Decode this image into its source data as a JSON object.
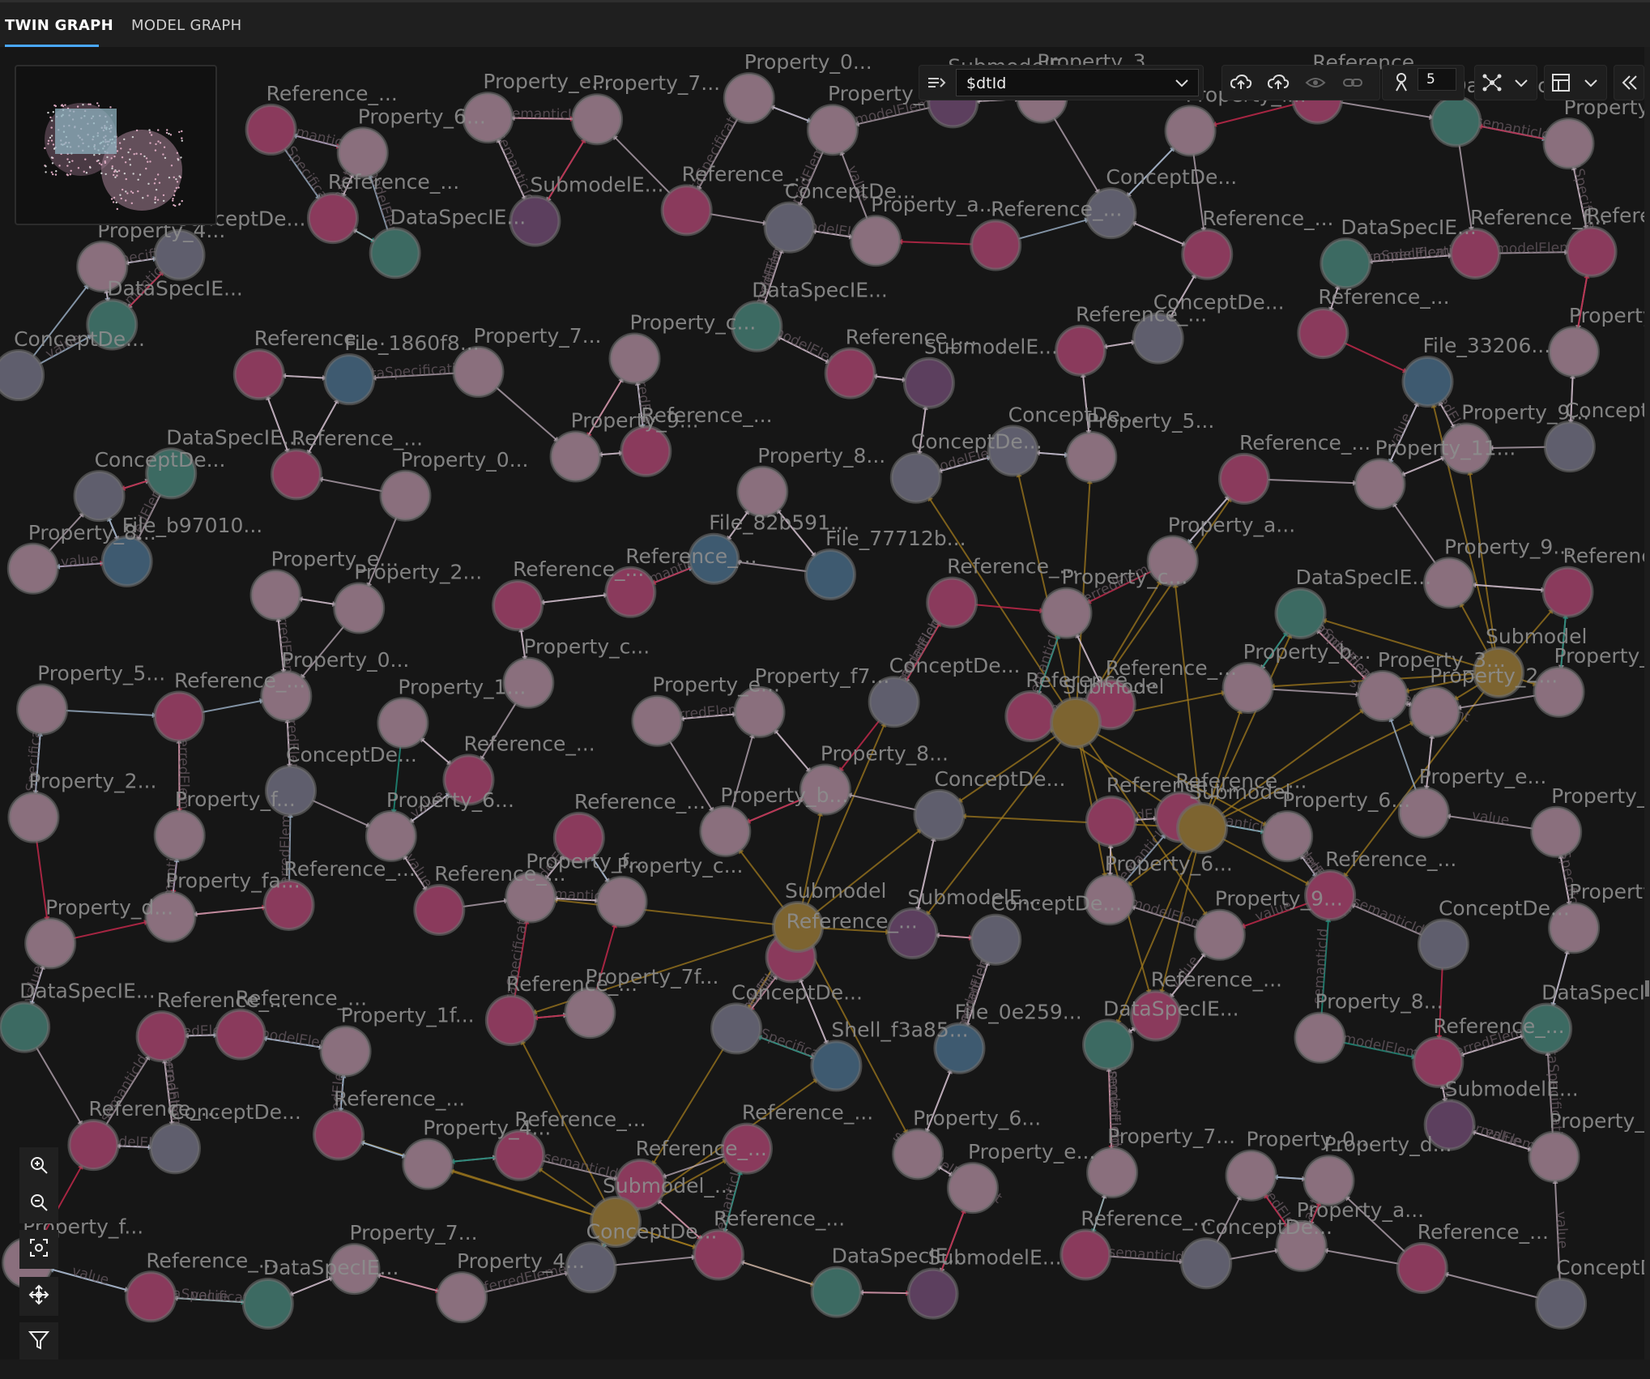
{
  "tabs": [
    {
      "label": "TWIN GRAPH",
      "active": true
    },
    {
      "label": "MODEL GRAPH",
      "active": false
    }
  ],
  "toolbar": {
    "query_value": "$dtId",
    "hops_value": "5",
    "icons": [
      "query-options-icon",
      "upload-models-icon",
      "import-graph-icon",
      "eye-icon",
      "link-icon",
      "relationship-hops-icon",
      "layout-icon",
      "layout-dropdown-icon",
      "table-view-icon",
      "table-view-dropdown-icon",
      "collapse-panel-icon"
    ]
  },
  "zoom_controls": [
    "zoom-in-icon",
    "zoom-out-icon",
    "fit-screen-icon",
    "center-icon",
    "filter-icon"
  ],
  "colors": {
    "reference": "#8a3a5c",
    "property": "#8a6f7d",
    "dataspec": "#3c6a62",
    "concept": "#5f5e6d",
    "submodel": "#7d6430",
    "file": "#3e5a70",
    "submodel_elem": "#5c3f5e",
    "edge_light": "#c9b7c4",
    "edge_gold": "#a07a1e",
    "edge_red": "#c0284a",
    "edge_steel": "#9eb3c9",
    "edge_teal": "#1f8a78"
  },
  "graph": {
    "hubs": [
      {
        "label": "Submodel",
        "type": "submodel"
      },
      {
        "label": "Submodel",
        "type": "submodel"
      },
      {
        "label": "Submodel",
        "type": "submodel"
      },
      {
        "label": "Submodel",
        "type": "submodel"
      },
      {
        "label": "Submodel_...",
        "type": "submodel"
      }
    ],
    "node_labels": [
      "Reference_...",
      "Property_6...",
      "Property_e...",
      "Property_7...",
      "Property_0...",
      "Property_d...",
      "SubmodelE...",
      "Property_3...",
      "Property_f...",
      "Reference_...",
      "DataSpecIE...",
      "Property_7...",
      "Property_4...",
      "ConceptDe...",
      "Reference_...",
      "DataSpecIE...",
      "SubmodelE...",
      "Reference_...",
      "ConceptDe...",
      "Property_a...",
      "Reference_...",
      "ConceptDe...",
      "Reference_...",
      "DataSpecIE...",
      "Reference_f...",
      "Reference_...",
      "ConceptDe...",
      "DataSpecIE...",
      "Reference_...",
      "File_1860f8...",
      "Property_7...",
      "Property_c...",
      "DataSpecIE...",
      "Reference_...",
      "SubmodelE...",
      "Reference_...",
      "ConceptDe...",
      "Reference_...",
      "File_33206...",
      "Property_a...",
      "ConceptDe...",
      "DataSpecIE...",
      "Reference_...",
      "Property_0...",
      "Property_9...",
      "Reference_...",
      "Property_8...",
      "ConceptDe...",
      "ConceptDe...",
      "Property_5...",
      "Reference_...",
      "Property_11...",
      "Property_9...",
      "ConceptDe...",
      "Property_8...",
      "File_b97010...",
      "Property_e...",
      "Property_2...",
      "Reference_...",
      "Reference_...",
      "File_82b591...",
      "File_77712b...",
      "Reference_...",
      "Property_c...",
      "Property_a...",
      "DataSpecIE...",
      "Property_9...",
      "Reference_...",
      "Property_5...",
      "Reference_...",
      "Property_0...",
      "Property_1...",
      "Property_c...",
      "Property_e...",
      "Property_f7...",
      "ConceptDe...",
      "Reference_...",
      "Reference_...",
      "Property_b...",
      "Property_3...",
      "Property_2...",
      "Property_d...",
      "Property_2...",
      "Property_f...",
      "ConceptDe...",
      "Property_6...",
      "Reference_...",
      "Reference_...",
      "Property_b...",
      "Property_8...",
      "ConceptDe...",
      "Reference_...",
      "Reference_...",
      "Property_6...",
      "Property_e...",
      "Property_a...",
      "Property_d...",
      "Property_fa...",
      "Reference_...",
      "Reference_...",
      "Property_f...",
      "Property_c...",
      "Reference_...",
      "SubmodelE...",
      "ConceptDe...",
      "Property_6...",
      "Property_9...",
      "Reference_...",
      "ConceptDe...",
      "Property_0...",
      "DataSpecIE...",
      "Reference_...",
      "Reference_...",
      "Property_1f...",
      "Reference_...",
      "Property_7f...",
      "ConceptDe...",
      "Shell_f3a85...",
      "File_0e259...",
      "DataSpecIE...",
      "Reference_...",
      "Property_8...",
      "Reference_...",
      "DataSpecIE...",
      "Reference_...",
      "ConceptDe...",
      "Reference_...",
      "Property_4...",
      "Reference_...",
      "Reference_..."
    ],
    "edge_labels": [
      "semanticId",
      "referredElement",
      "dataSpecification",
      "value",
      "submodelElement"
    ]
  }
}
